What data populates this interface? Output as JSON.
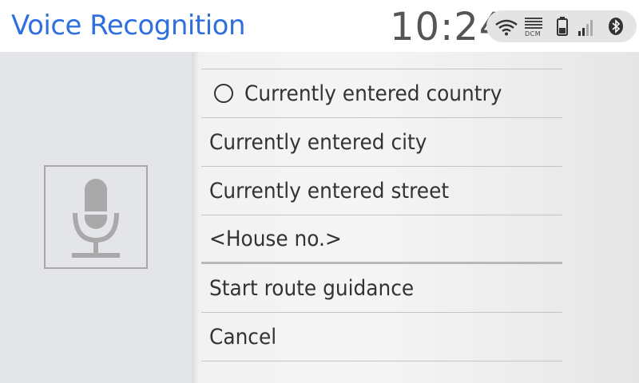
{
  "header": {
    "title": "Voice Recognition",
    "clock": "10:24",
    "status_icons": [
      "wifi-icon",
      "dcm-icon",
      "battery-icon",
      "signal-bars-icon",
      "bluetooth-icon"
    ],
    "dcm_label": "DCM"
  },
  "left_panel": {
    "icon": "microphone-icon"
  },
  "menu": {
    "items": [
      {
        "label": "Currently entered country",
        "radio": true
      },
      {
        "label": "Currently entered  city"
      },
      {
        "label": "Currently entered  street"
      },
      {
        "label": "<House no.>"
      },
      {
        "label": "Start route guidance"
      },
      {
        "label": "Cancel"
      }
    ]
  },
  "colors": {
    "title": "#2f6fe0",
    "text": "#333333",
    "left_panel_bg": "#e4e5e8",
    "status_pill_bg": "#e4e4e4"
  }
}
